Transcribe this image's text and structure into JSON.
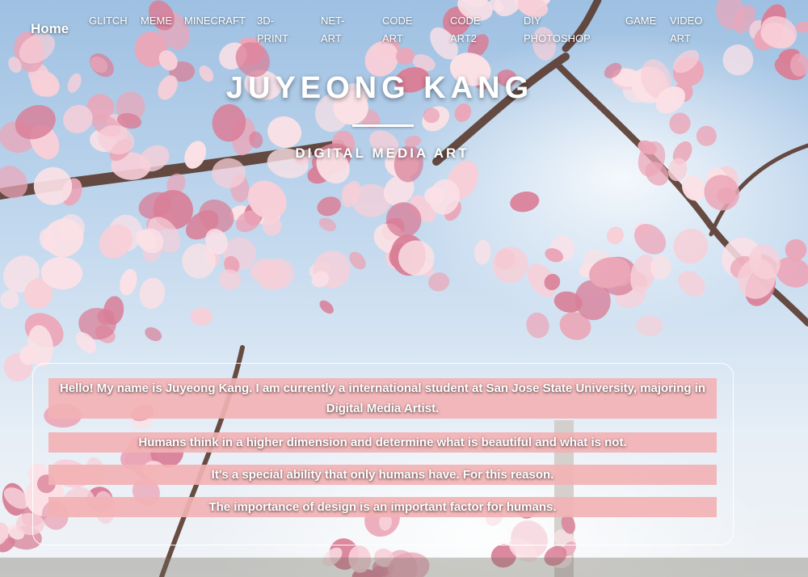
{
  "nav": {
    "home": "Home",
    "items": [
      {
        "label": "GLITCH",
        "active": true
      },
      {
        "label": "MEME"
      },
      {
        "label": "MINECRAFT"
      },
      {
        "label": "3D-\nPRINT"
      },
      {
        "label": "NET-\nART"
      },
      {
        "label": "CODE\nART"
      },
      {
        "label": "CODE\nART2"
      },
      {
        "label": "DIY\nPHOTOSHOP"
      },
      {
        "label": "GAME"
      },
      {
        "label": "VIDEO\nART"
      }
    ]
  },
  "hero": {
    "title": "JUYEONG KANG",
    "subtitle": "DIGITAL MEDIA ART"
  },
  "intro": {
    "lines": [
      "Hello! My name is Juyeong Kang. I am currently a international student at San Jose State University, majoring in Digital Media Artist.",
      "Humans think in a higher dimension and determine what is beautiful and what is not.",
      "It's a special ability that only humans have. For this reason.",
      "The importance of design is an important factor for humans."
    ]
  },
  "colors": {
    "highlight": "#f2b2b4",
    "blossom_light": "#f7cfd8",
    "blossom_mid": "#eba6b8",
    "blossom_dark": "#d97f98",
    "branch": "#5a3a2e",
    "sky": "#9ec0e2"
  }
}
